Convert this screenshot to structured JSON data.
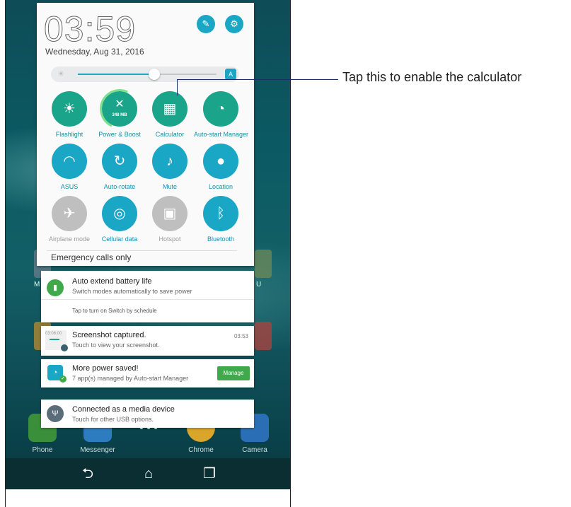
{
  "clock": {
    "time": "03:59",
    "date": "Wednesday, Aug 31, 2016"
  },
  "header_buttons": {
    "edit_icon": "edit-icon",
    "settings_icon": "gear-icon"
  },
  "brightness": {
    "level": 0.55
  },
  "quick_settings": [
    {
      "label": "Flashlight",
      "icon": "flashlight-icon",
      "state": "on",
      "color": "teal"
    },
    {
      "label": "Power & Boost",
      "icon": "boost-icon",
      "state": "on",
      "color": "teal",
      "badge": "348 MB"
    },
    {
      "label": "Calculator",
      "icon": "calculator-icon",
      "state": "on",
      "color": "teal"
    },
    {
      "label": "Auto-start Manager",
      "icon": "gauge-icon",
      "state": "on",
      "color": "teal"
    },
    {
      "label": "ASUS",
      "icon": "wifi-icon",
      "state": "on",
      "color": "blue"
    },
    {
      "label": "Auto-rotate",
      "icon": "rotate-icon",
      "state": "on",
      "color": "blue"
    },
    {
      "label": "Mute",
      "icon": "speaker-icon",
      "state": "on",
      "color": "blue"
    },
    {
      "label": "Location",
      "icon": "location-pin-icon",
      "state": "on",
      "color": "blue"
    },
    {
      "label": "Airplane mode",
      "icon": "airplane-icon",
      "state": "off",
      "color": "gray"
    },
    {
      "label": "Cellular data",
      "icon": "globe-data-icon",
      "state": "on",
      "color": "blue"
    },
    {
      "label": "Hotspot",
      "icon": "hotspot-icon",
      "state": "off",
      "color": "gray"
    },
    {
      "label": "Bluetooth",
      "icon": "bluetooth-icon",
      "state": "on",
      "color": "blue"
    }
  ],
  "emergency": "Emergency calls only",
  "notifications": {
    "battery": {
      "title": "Auto extend battery life",
      "subtitle": "Switch modes automatically to save power",
      "action": "Tap to turn on Switch by schedule"
    },
    "screenshot": {
      "title": "Screenshot captured.",
      "subtitle": "Touch to view your screenshot.",
      "time": "03:53",
      "thumb_time": "03:06:00"
    },
    "power": {
      "title": "More power saved!",
      "subtitle": "7 app(s) managed by Auto-start Manager",
      "button": "Manage"
    },
    "usb": {
      "title": "Connected as a media device",
      "subtitle": "Touch for other USB options."
    }
  },
  "home_fragments": {
    "left_letter": "M",
    "right_letter": "U"
  },
  "dock": [
    {
      "label": "Phone",
      "color": "#3a8f3a"
    },
    {
      "label": "Messenger",
      "color": "#2d7cc0"
    },
    {
      "label": "Chrome",
      "color": "#d9a52a"
    },
    {
      "label": "Camera",
      "color": "#2a6fb5"
    }
  ],
  "callout": "Tap this to enable the calculator",
  "colors": {
    "teal": "#1aa58a",
    "blue": "#1aa7c6",
    "off": "#bfbfbf",
    "manage": "#40a94b"
  }
}
